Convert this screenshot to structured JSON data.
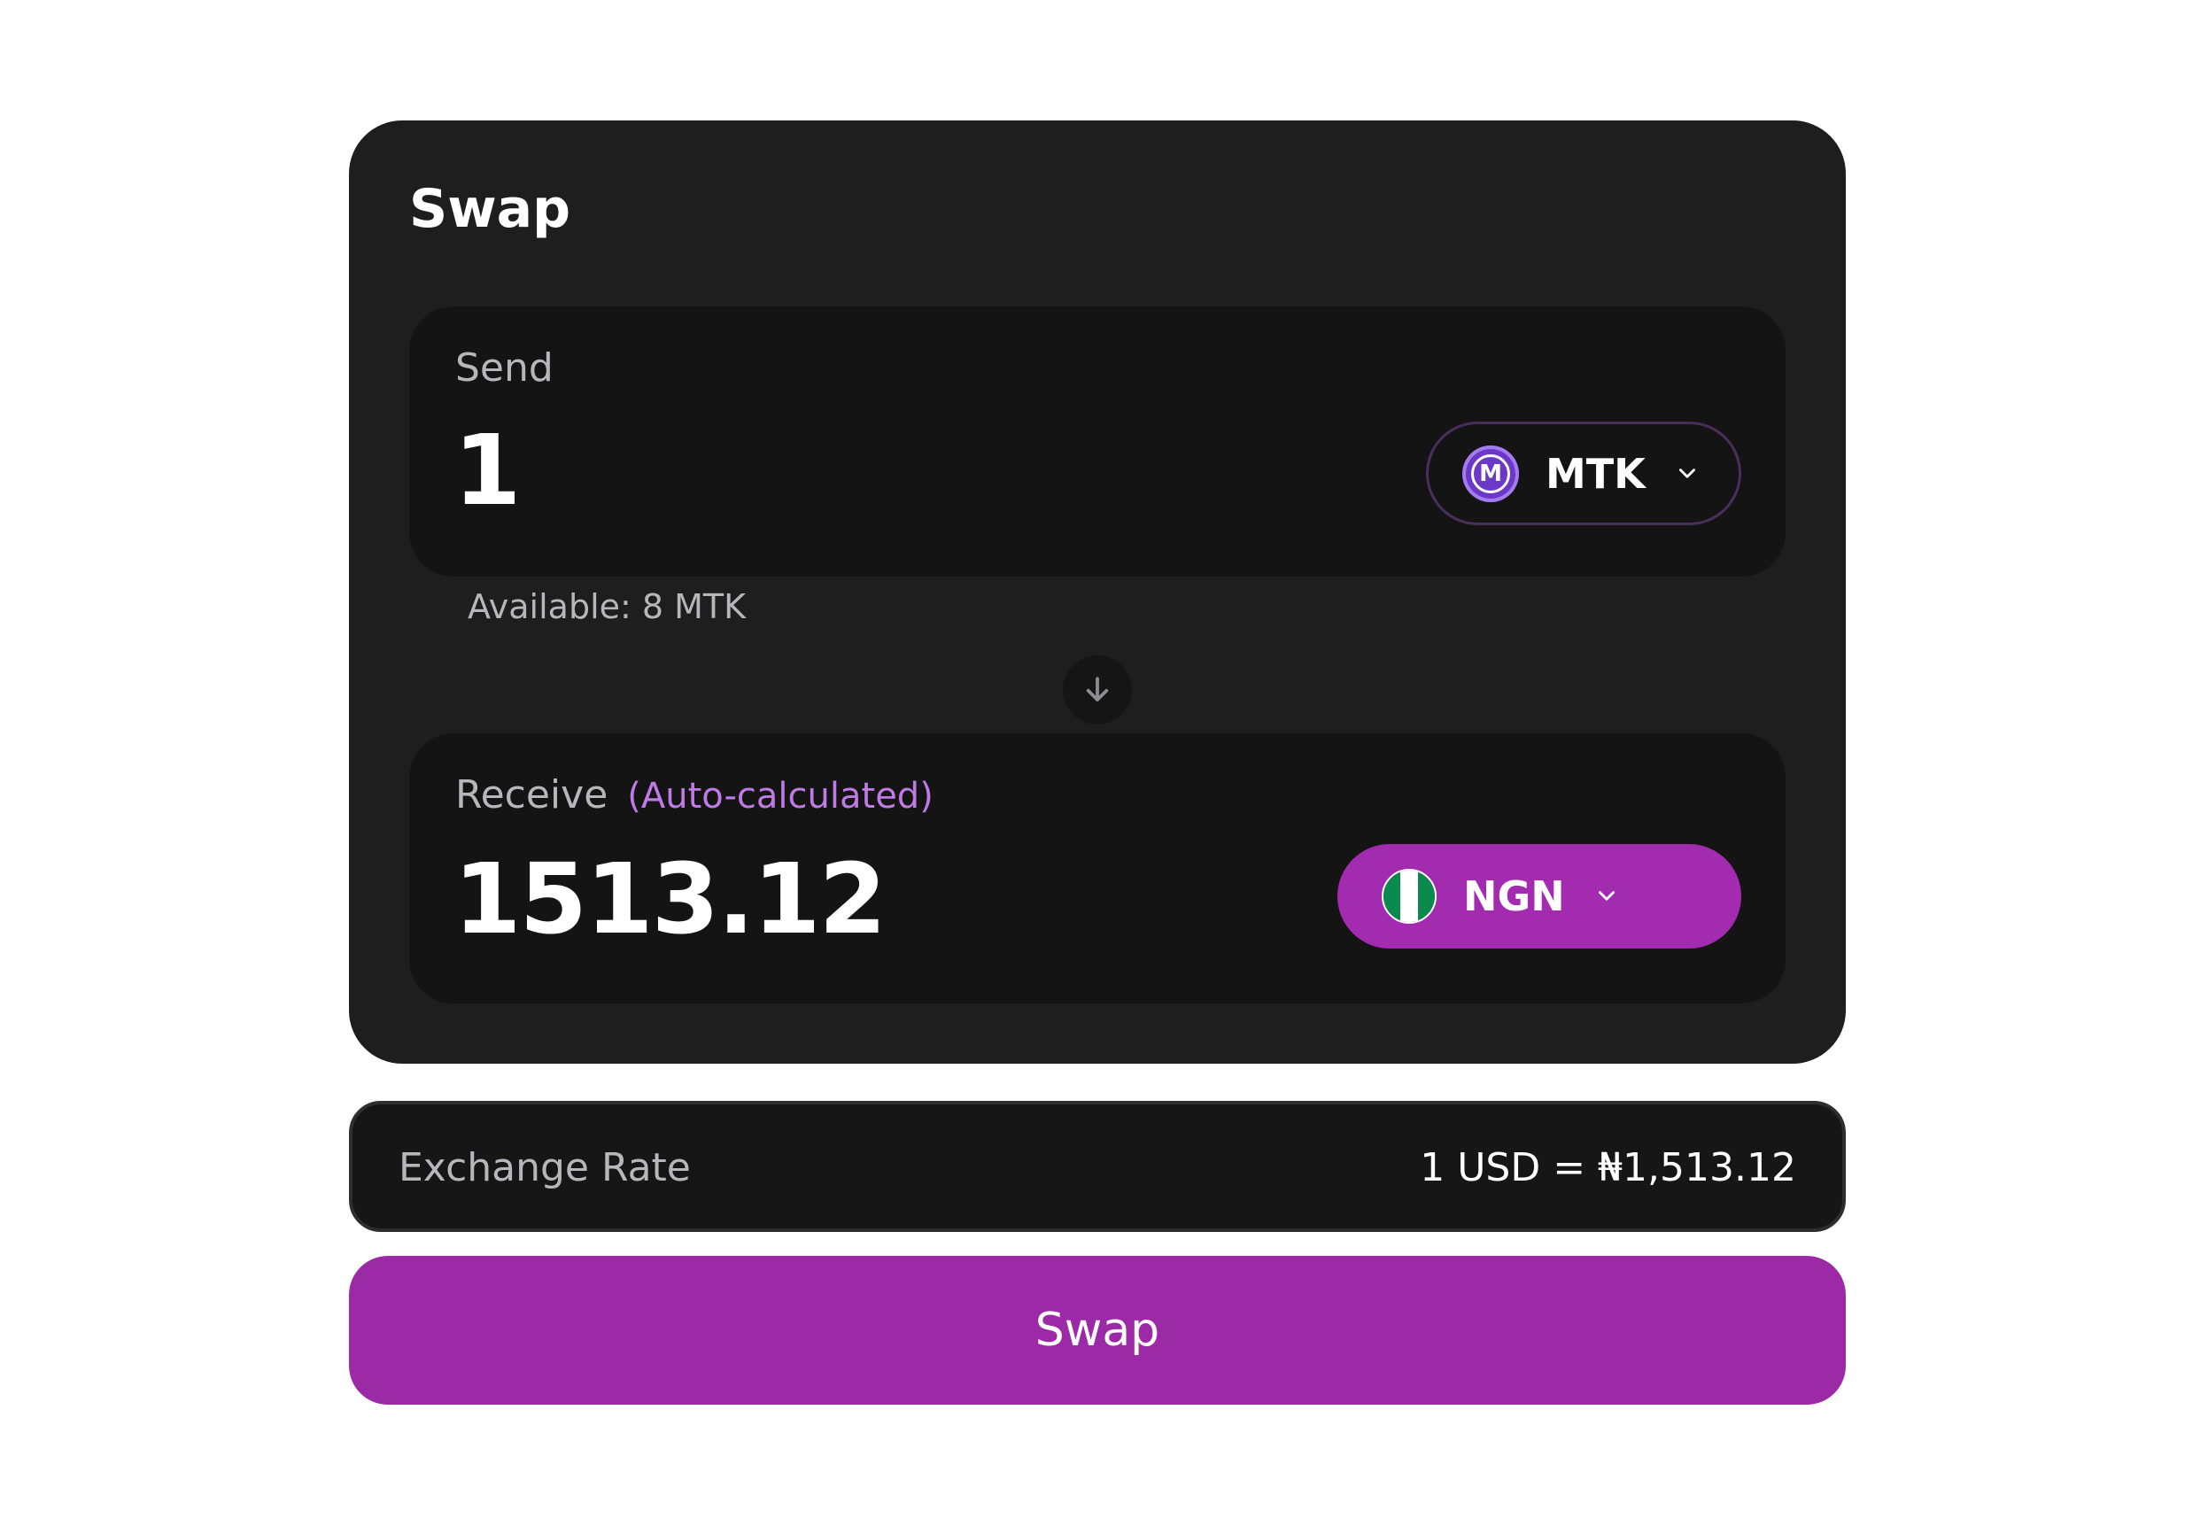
{
  "colors": {
    "card_bg": "#1e1e1e",
    "panel_bg": "#141414",
    "accent": "#9c29a6",
    "hint": "#c07ae6"
  },
  "card": {
    "title": "Swap"
  },
  "send": {
    "label": "Send",
    "amount": "1",
    "token": {
      "symbol": "MTK",
      "icon": "mtk-token-icon",
      "icon_letter": "M"
    },
    "available": "Available: 8 MTK"
  },
  "direction_icon": "arrow-down-icon",
  "receive": {
    "label": "Receive",
    "hint": "(Auto-calculated)",
    "amount": "1513.12",
    "token": {
      "symbol": "NGN",
      "icon": "nigeria-flag-icon"
    }
  },
  "exchange_rate": {
    "label": "Exchange Rate",
    "value": "1 USD = ₦1,513.12"
  },
  "swap_button": {
    "label": "Swap"
  }
}
